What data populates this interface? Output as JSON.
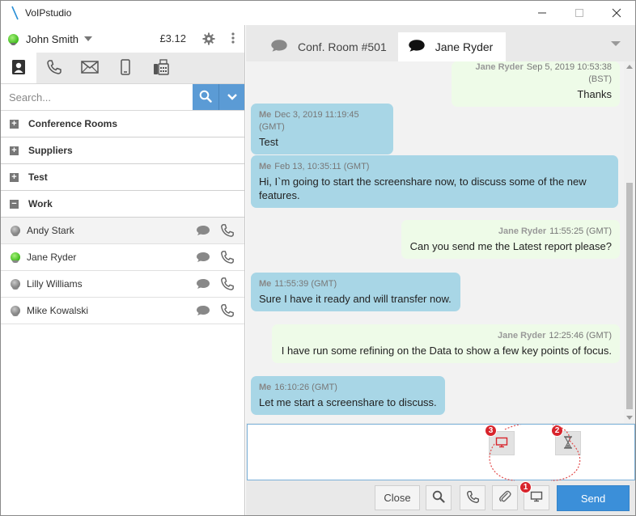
{
  "window": {
    "title": "VoIPstudio",
    "controls": [
      "minimize",
      "maximize",
      "close"
    ]
  },
  "user": {
    "name": "John Smith",
    "credit": "£3.12",
    "status_color": "#3cb81a"
  },
  "left_tabs": [
    "contacts",
    "calls",
    "email",
    "mobile",
    "fax"
  ],
  "search": {
    "placeholder": "Search..."
  },
  "groups": [
    {
      "label": "Conference Rooms",
      "state": "collapsed",
      "sign": "+"
    },
    {
      "label": "Suppliers",
      "state": "collapsed",
      "sign": "+"
    },
    {
      "label": "Test",
      "state": "collapsed",
      "sign": "+"
    },
    {
      "label": "Work",
      "state": "expanded",
      "sign": "−"
    }
  ],
  "contacts": [
    {
      "name": "Andy Stark",
      "status": "offline"
    },
    {
      "name": "Jane Ryder",
      "status": "online"
    },
    {
      "name": "Lilly Williams",
      "status": "offline"
    },
    {
      "name": "Mike Kowalski",
      "status": "offline"
    }
  ],
  "chat_tabs": [
    {
      "label": "Conf. Room #501",
      "active": false
    },
    {
      "label": "Jane Ryder",
      "active": true
    }
  ],
  "messages": [
    {
      "from": "them",
      "sender": "Jane Ryder",
      "time": "Sep 5, 2019 10:53:38 (BST)",
      "text": "Thanks"
    },
    {
      "from": "me",
      "sender": "Me",
      "time": "Dec 3, 2019 11:19:45 (GMT)",
      "text": "Test"
    },
    {
      "from": "me",
      "sender": "Me",
      "time": "Feb 13, 10:35:11 (GMT)",
      "text": "Hi, I`m going to start the screenshare now, to discuss some of the new features."
    },
    {
      "from": "them",
      "sender": "Jane Ryder",
      "time": "11:55:25 (GMT)",
      "text": "Can you send me the Latest report please?"
    },
    {
      "from": "me",
      "sender": "Me",
      "time": "11:55:39 (GMT)",
      "text": "Sure I have it ready and will transfer now."
    },
    {
      "from": "them",
      "sender": "Jane Ryder",
      "time": "12:25:46 (GMT)",
      "text": "I have run some refining on the Data to show a few key points of focus."
    },
    {
      "from": "me",
      "sender": "Me",
      "time": "16:10:26 (GMT)",
      "text": "Let me start a screenshare to discuss."
    }
  ],
  "overlay": {
    "badges": [
      "1",
      "2",
      "3"
    ]
  },
  "actions": {
    "close_label": "Close",
    "send_label": "Send"
  },
  "colors": {
    "accent": "#3b8fd9",
    "my_bubble": "#a8d6e6",
    "their_bubble": "#eefbe8",
    "badge": "#d8242c"
  }
}
